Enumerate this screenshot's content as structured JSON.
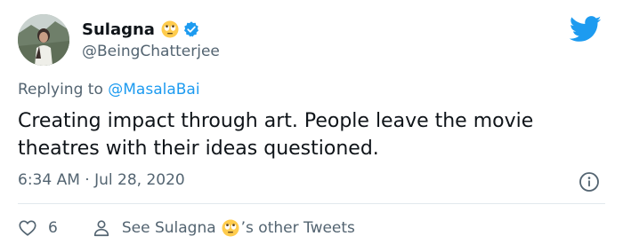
{
  "author": {
    "display_name": "Sulagna",
    "handle": "@BeingChatterjee"
  },
  "reply": {
    "prefix": "Replying to",
    "mention": "@MasalaBai"
  },
  "tweet": {
    "text": "Creating impact through art. People leave the movie theatres with their ideas questioned.",
    "timestamp": "6:34 AM · Jul 28, 2020"
  },
  "actions": {
    "like_count": "6",
    "see_prefix": "See Sulagna",
    "see_suffix": "’s other Tweets"
  },
  "icons": {
    "bird": "twitter-bird-icon",
    "verified": "verified-badge-icon",
    "emoji": "rolling-eyes-emoji-icon",
    "info": "info-icon",
    "heart": "heart-icon",
    "person": "person-icon"
  },
  "colors": {
    "accent": "#1d9bf0",
    "secondary_text": "#536471",
    "primary_text": "#0f1419",
    "divider": "#e1e8ed"
  }
}
